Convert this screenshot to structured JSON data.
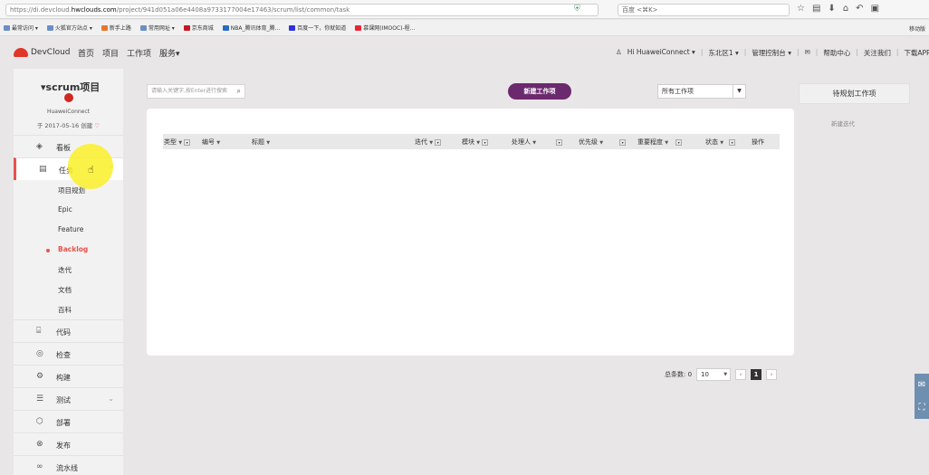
{
  "browser": {
    "url_prefix": "https://di.devcloud.",
    "url_domain": "hwclouds.com",
    "url_path": "/project/941d051a06e4408a9733177004e17463/scrum/list/common/task",
    "search_placeholder": "百度 <⌘K>"
  },
  "bookmarks": {
    "items": [
      "最常访问 ▾",
      "火狐官方站点 ▾",
      "新手上路",
      "常用网址 ▾",
      "京东商城",
      "NBA_腾讯体育_腾...",
      "百度一下，你就知道",
      "慕课网(IMOOC)-程..."
    ],
    "right": "移动版"
  },
  "nav": {
    "logo": "DevCloud",
    "links": [
      "首页",
      "项目",
      "工作项",
      "服务▾"
    ],
    "right": [
      "Hi HuaweiConnect ▾",
      "东北区1 ▾",
      "管理控制台 ▾",
      "帮助中心",
      "关注我们",
      "下载APP"
    ]
  },
  "project": {
    "name": "▾scrum项目",
    "owner": "HuaweiConnect",
    "created": "于 2017-05-16 创建"
  },
  "sidebar": {
    "items": [
      {
        "label": "看板",
        "icon": "dashboard-icon"
      },
      {
        "label": "任务",
        "icon": "document-icon"
      },
      {
        "label": "代码",
        "icon": "code-icon"
      },
      {
        "label": "检查",
        "icon": "check-icon"
      },
      {
        "label": "构建",
        "icon": "build-icon"
      },
      {
        "label": "测试",
        "icon": "test-icon"
      },
      {
        "label": "部署",
        "icon": "deploy-icon"
      },
      {
        "label": "发布",
        "icon": "release-icon"
      },
      {
        "label": "流水线",
        "icon": "pipeline-icon"
      }
    ],
    "subitems": [
      "项目规划",
      "Epic",
      "Feature",
      "Backlog",
      "迭代",
      "文档",
      "百科"
    ]
  },
  "toolbar": {
    "search_placeholder": "请输入关键字,按Enter进行搜索",
    "new_button": "新建工作项",
    "filter_value": "所有工作项"
  },
  "table": {
    "columns": [
      "类型",
      "编号",
      "标题",
      "迭代",
      "模块",
      "处理人",
      "优先级",
      "重要程度",
      "状态",
      "操作"
    ]
  },
  "right_panel": {
    "plan_button": "待规划工作项",
    "new_iteration": "新建迭代"
  },
  "pager": {
    "total_label": "总条数: 0",
    "page_size": "10",
    "current_page": "1"
  }
}
